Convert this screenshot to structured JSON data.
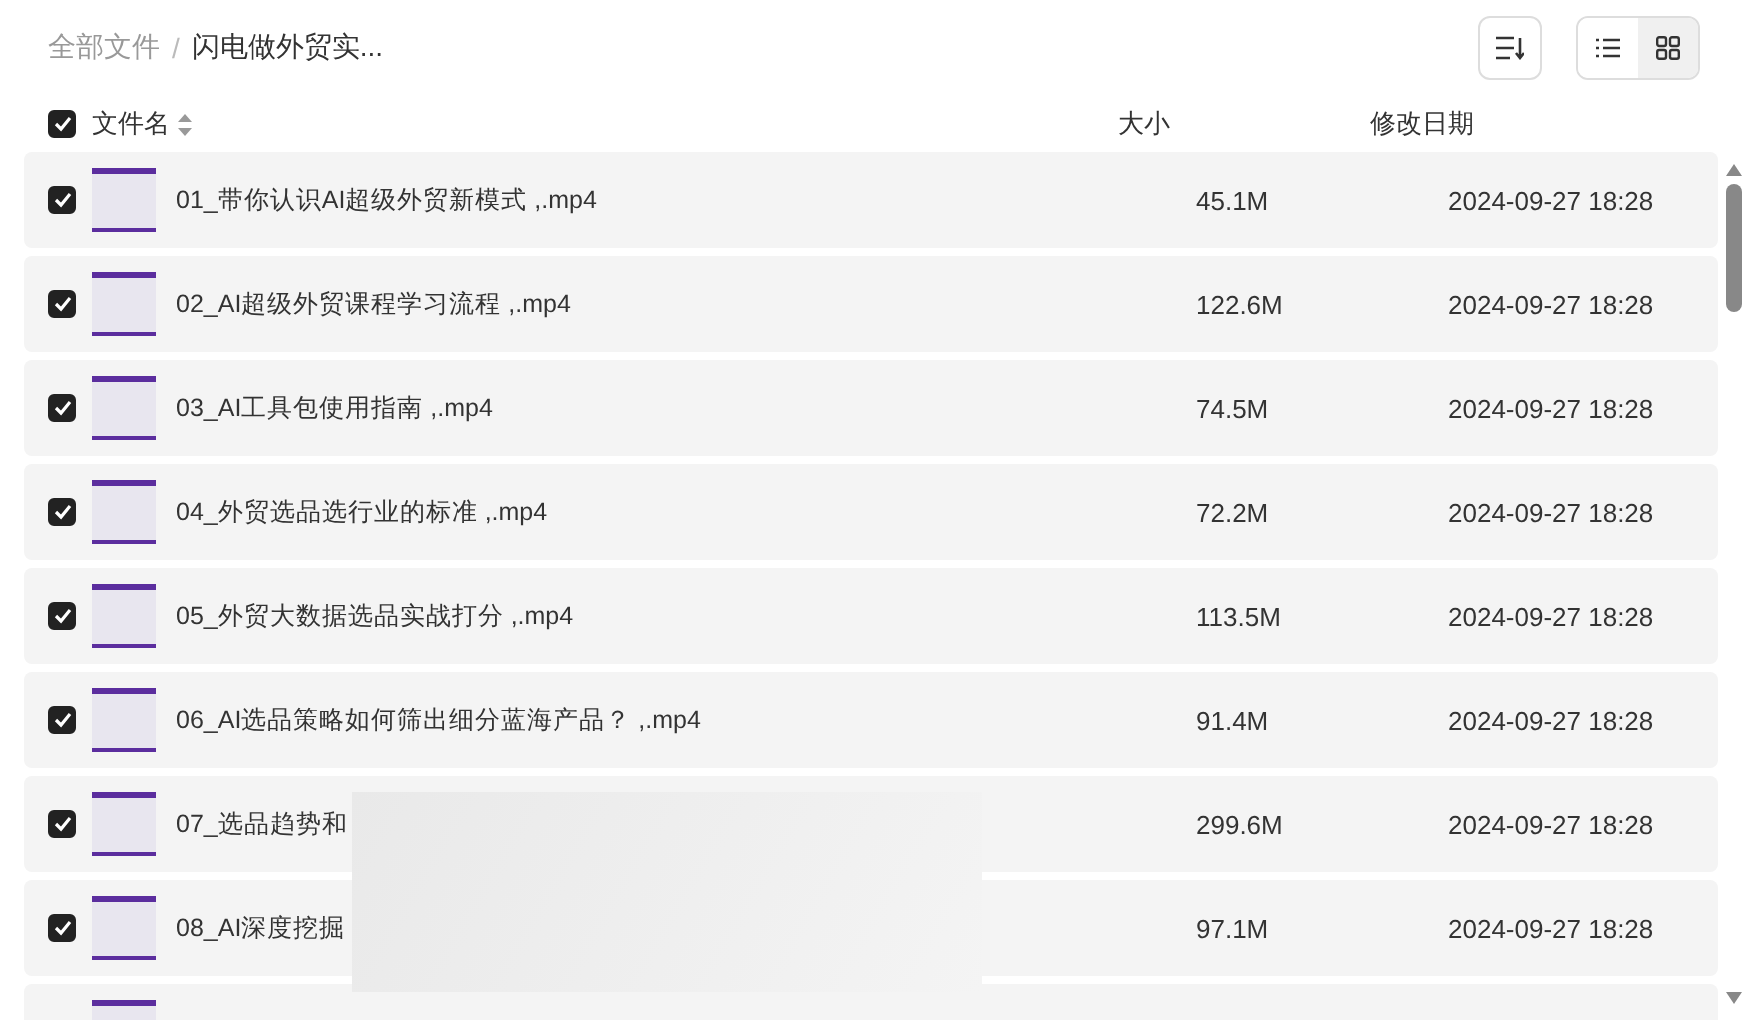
{
  "breadcrumb": [
    {
      "label": "全部文件",
      "current": false
    },
    {
      "label": "闪电做外贸实...",
      "current": true
    }
  ],
  "breadcrumb_separator": "/",
  "views": [
    {
      "kind": "list",
      "selected": false
    },
    {
      "kind": "grid",
      "selected": true
    }
  ],
  "table": {
    "select_all": {
      "checked": true
    },
    "columns": [
      "文件名",
      "大小",
      "修改日期"
    ],
    "rows": [
      {
        "checked": true,
        "name": "01_带你认识AI超级外贸新模式 ,.mp4",
        "size": "45.1M",
        "modified": "2024-09-27 18:28"
      },
      {
        "checked": true,
        "name": "02_AI超级外贸课程学习流程 ,.mp4",
        "size": "122.6M",
        "modified": "2024-09-27 18:28"
      },
      {
        "checked": true,
        "name": "03_AI工具包使用指南 ,.mp4",
        "size": "74.5M",
        "modified": "2024-09-27 18:28"
      },
      {
        "checked": true,
        "name": "04_外贸选品选行业的标准 ,.mp4",
        "size": "72.2M",
        "modified": "2024-09-27 18:28"
      },
      {
        "checked": true,
        "name": "05_外贸大数据选品实战打分 ,.mp4",
        "size": "113.5M",
        "modified": "2024-09-27 18:28"
      },
      {
        "checked": true,
        "name": "06_AI选品策略如何筛出细分蓝海产品？ ,.mp4",
        "size": "91.4M",
        "modified": "2024-09-27 18:28"
      },
      {
        "checked": true,
        "name": "07_选品趋势和",
        "size": "299.6M",
        "modified": "2024-09-27 18:28"
      },
      {
        "checked": true,
        "name": "08_AI深度挖掘",
        "size": "97.1M",
        "modified": "2024-09-27 18:28"
      },
      {
        "kind": "partial"
      }
    ]
  }
}
